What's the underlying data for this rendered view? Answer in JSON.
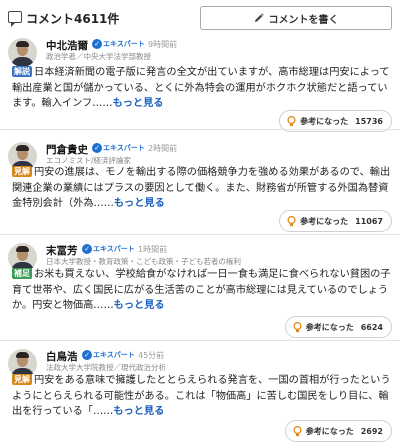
{
  "header": {
    "title": "コメント4611件",
    "write_button": "コメントを書く",
    "icon": "comment-icon"
  },
  "expert_label": "エキスパート",
  "helpful_label": "参考になった",
  "colors": {
    "accent_blue": "#1f6fd0",
    "link_blue": "#1a5fc0",
    "tag_kaisetsu": "#3c74c4",
    "tag_kenkai": "#d6861e",
    "tag_hosoku": "#3c9a57",
    "bulb_orange": "#e08a1e"
  },
  "comments": [
    {
      "name": "中北浩爾",
      "time": "9時間前",
      "title": "政治学者／中央大学法学部教授",
      "tag": "解説",
      "text": "日本経済新聞の電子版に発言の全文が出ていますが、高市総理は円安によって輸出産業と国が儲かっている、とくに外為特会の運用がホクホク状態だと語っています。輸入インフ……",
      "more": "もっと見る",
      "helpful_count": "15736"
    },
    {
      "name": "門倉貴史",
      "time": "2時間前",
      "title": "エコノミスト/経済評論家",
      "tag": "見解",
      "text": "円安の進展は、モノを輸出する際の価格競争力を強める効果があるので、輸出関連企業の業績にはプラスの要因として働く。また、財務省が所管する外国為替資金特別会計（外為……",
      "more": "もっと見る",
      "helpful_count": "11067"
    },
    {
      "name": "末冨芳",
      "time": "1時間前",
      "title": "日本大学教授・教育政策・こども政策・子ども若者の権利",
      "tag": "補足",
      "text": "お米も買えない、学校給食がなければ一日一食も満足に食べられない貧困の子育て世帯や、広く国民に広がる生活苦のことが高市総理には見えているのでしょうか。円安と物価高……",
      "more": "もっと見る",
      "helpful_count": "6624"
    },
    {
      "name": "白鳥浩",
      "time": "45分前",
      "title": "法政大学大学院教授／現代政治分析",
      "tag": "見解",
      "text": "円安をある意味で擁護したととらえられる発言を、一国の首相が行ったというようにとらえられる可能性がある。これは「物価高」に苦しむ国民をしり目に、輸出を行っている「……",
      "more": "もっと見る",
      "helpful_count": "2692"
    }
  ]
}
